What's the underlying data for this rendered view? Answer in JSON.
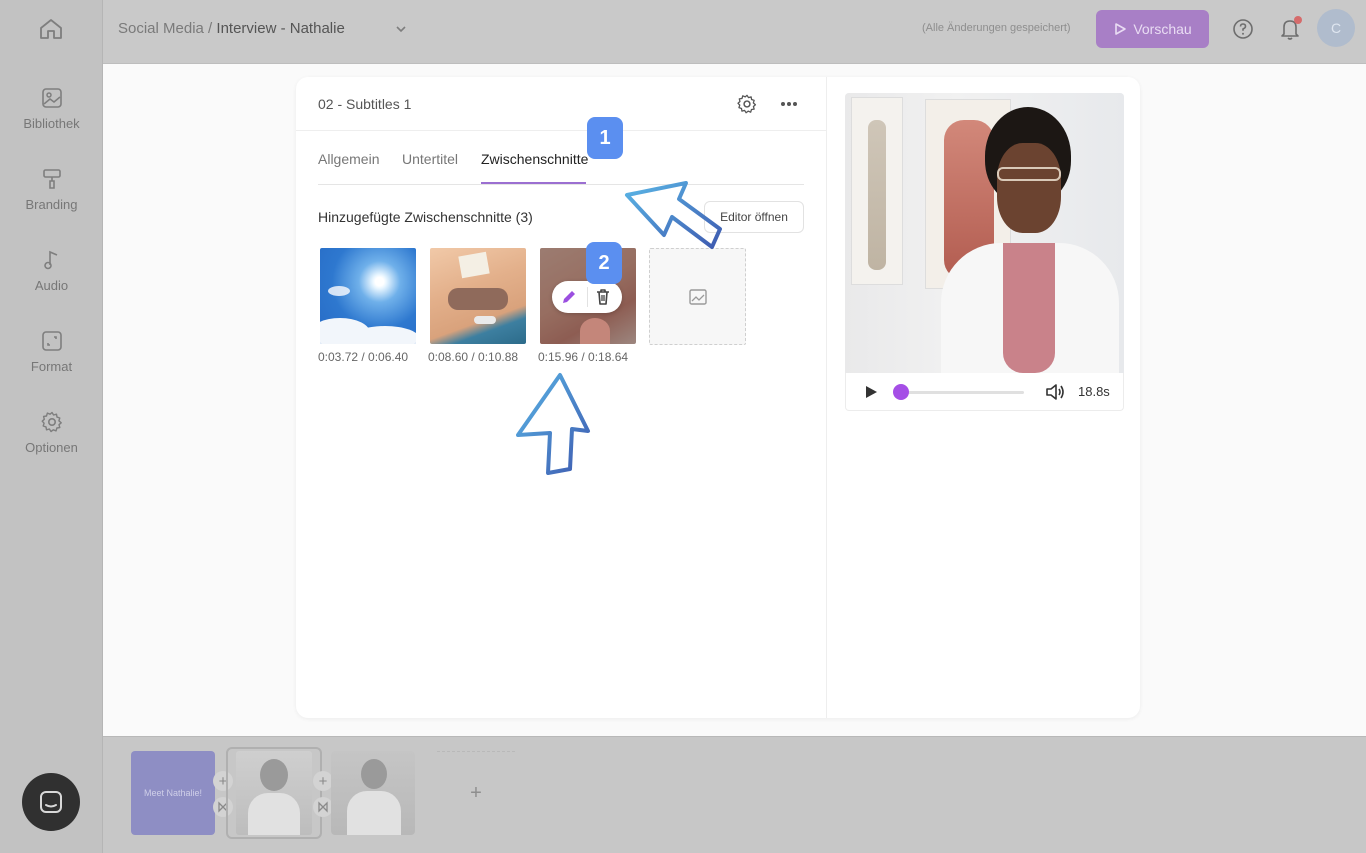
{
  "sidebar": {
    "home_icon": "home-icon",
    "items": [
      {
        "label": "Bibliothek",
        "icon": "image-icon"
      },
      {
        "label": "Branding",
        "icon": "paint-roller-icon"
      },
      {
        "label": "Audio",
        "icon": "music-note-icon"
      },
      {
        "label": "Format",
        "icon": "resize-icon"
      },
      {
        "label": "Optionen",
        "icon": "gear-icon"
      }
    ]
  },
  "topbar": {
    "breadcrumb_parent": "Social Media",
    "breadcrumb_sep": " / ",
    "breadcrumb_current": "Interview - Nathalie",
    "saved_status": "(Alle Änderungen gespeichert)",
    "preview_label": "Vorschau",
    "avatar_initial": "C"
  },
  "panel": {
    "title": "02 - Subtitles 1",
    "tabs": [
      {
        "label": "Allgemein"
      },
      {
        "label": "Untertitel"
      },
      {
        "label": "Zwischenschnitte",
        "active": true
      }
    ],
    "section_title": "Hinzugefügte Zwischenschnitte (3)",
    "editor_button": "Editor öffnen",
    "cutaways": [
      {
        "time": "0:03.72 / 0:06.40",
        "image": "sky-sun"
      },
      {
        "time": "0:08.60 / 0:10.88",
        "image": "beach-reading"
      },
      {
        "time": "0:15.96 / 0:18.64",
        "image": "skin-closeup"
      }
    ]
  },
  "annotations": {
    "badge1": "1",
    "badge2": "2"
  },
  "video": {
    "duration": "18.8s",
    "progress": 0.0
  },
  "timeline": {
    "intro_clip_text": "Meet Nathalie!",
    "add_label": "+"
  },
  "colors": {
    "accent": "#9b6fd1",
    "preview_button": "#a87fc6",
    "badge": "#5b8ff0",
    "slider_knob": "#a54fe6"
  }
}
